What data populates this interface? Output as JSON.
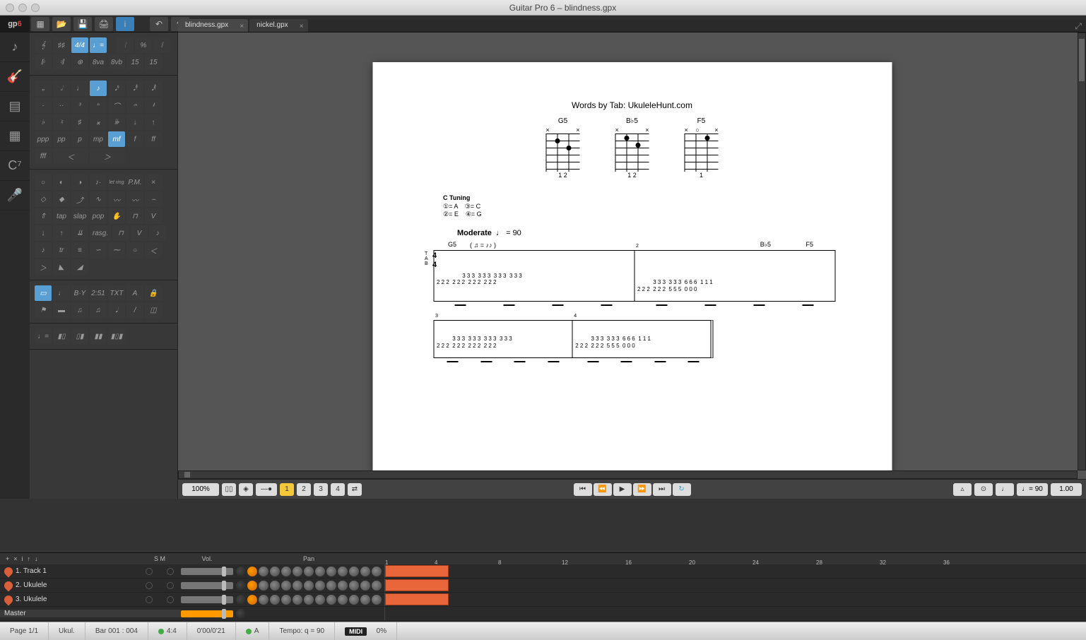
{
  "window": {
    "title": "Guitar Pro 6 – blindness.gpx"
  },
  "logo": {
    "prefix": "gp",
    "suffix": "6"
  },
  "tabs": [
    {
      "label": "blindness.gpx"
    },
    {
      "label": "nickel.gpx"
    }
  ],
  "score": {
    "words_by": "Words by Tab: UkuleleHunt.com",
    "chords": [
      {
        "name": "G5",
        "fingers": "1  2"
      },
      {
        "name": "B♭5",
        "fingers": "1  2"
      },
      {
        "name": "F5",
        "fingers": "1"
      }
    ],
    "tuning_title": "C Tuning",
    "tuning": "①= A    ③= C\n②= E    ④= G",
    "tempo_label": "Moderate",
    "tempo_mark": "♩ = 90",
    "swing": "( ♫ = ♪♪ )",
    "bar1_chord": "G5",
    "bar2_chord": "B♭5",
    "bar2_chord2": "F5",
    "tab_measures_row1": [
      "3 3 3  3 3 3  3 3 3  3 3 3\n2 2 2  2 2 2  2 2 2  2 2 2",
      "3 3 3  3 3 3  6 6 6  1 1 1\n2 2 2  2 2 2  5 5 5  0 0 0"
    ],
    "tab_measures_row2": [
      "3 3 3  3 3 3  3 3 3  3 3 3\n2 2 2  2 2 2  2 2 2  2 2 2",
      "3 3 3  3 3 3  6 6 6  1 1 1\n2 2 2  2 2 2  5 5 5  0 0 0"
    ],
    "measure_nums_row1": [
      "",
      "2"
    ],
    "measure_nums_row2": [
      "3",
      "4"
    ],
    "time_sig": "4\n4"
  },
  "view": {
    "zoom": "100% ",
    "pages": [
      "1",
      "2",
      "3",
      "4"
    ],
    "tempo_box": "♩= 90",
    "speed_box": "1.00 "
  },
  "trackhead": {
    "buttons": [
      "+",
      "×",
      "i",
      "↑",
      "↓"
    ],
    "sm": "S    M",
    "vol": "Vol.",
    "pan": "Pan",
    "ruler": [
      {
        "pos": 0,
        "label": "1"
      },
      {
        "pos": 70,
        "label": "4"
      },
      {
        "pos": 160,
        "label": "8"
      },
      {
        "pos": 250,
        "label": "12"
      },
      {
        "pos": 340,
        "label": "16"
      },
      {
        "pos": 430,
        "label": "20"
      },
      {
        "pos": 520,
        "label": "24"
      },
      {
        "pos": 610,
        "label": "28"
      },
      {
        "pos": 700,
        "label": "32"
      },
      {
        "pos": 790,
        "label": "36"
      }
    ]
  },
  "tracks": [
    {
      "name": "1. Track 1",
      "clip_left": 0,
      "clip_width": 90
    },
    {
      "name": "2. Ukulele",
      "clip_left": 0,
      "clip_width": 90
    },
    {
      "name": "3. Ukulele",
      "clip_left": 0,
      "clip_width": 90
    }
  ],
  "master": {
    "name": "Master"
  },
  "status": {
    "page": "Page 1/1",
    "track": "Ukul.",
    "bar": "Bar 001 : 004",
    "sig": "4:4",
    "time": "0'00/0'21",
    "key": "A",
    "tempo": "Tempo: q = 90",
    "midi": "MIDI",
    "load": "0%"
  },
  "dynamics": [
    "ppp",
    "pp",
    "p",
    "mp",
    "mf",
    "f",
    "ff",
    "fff"
  ],
  "techniques": [
    "tap",
    "slap",
    "pop"
  ],
  "rasg": "rasg.",
  "pm": "P.M.",
  "letring": "let\nring",
  "bartools": [
    "B·Y",
    "2:51",
    "TXT"
  ],
  "ottava": [
    "8va",
    "8vb"
  ]
}
